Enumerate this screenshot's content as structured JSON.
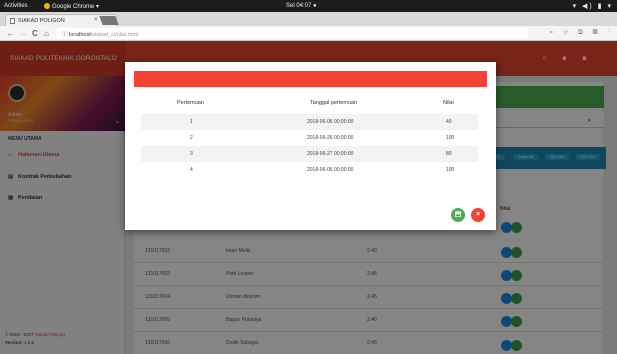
{
  "os": {
    "activities": "Activities",
    "app": "Google Chrome ▾",
    "clock": "Sel 04:07 ●",
    "sys_icons": "▾ ◀) ▮ ▾"
  },
  "browser": {
    "tab_title": "SIAKAD POLIGON",
    "tab_close": "×",
    "url_host": "localhost",
    "url_path": "/siakad_ci/nilai.html",
    "back": "←",
    "forward": "→",
    "reload": "C",
    "home": "⌂",
    "info": "ⓘ",
    "toolbar_icons": "⌕ ☆ ⧉ ▦ ⋮"
  },
  "app": {
    "brand": "SIAKAD POLITEKNIK GORONTALO",
    "header_icons": "⌕ ◼ ◼ ⋮",
    "profile": {
      "name": "Admin",
      "email": "Polgon.ac.id",
      "chevron": "⌄"
    },
    "menu_heading": "MENU UTAMA",
    "menu": [
      {
        "label": "Halaman Utama",
        "icon": "home-icon",
        "glyph": "⌂"
      },
      {
        "label": "Kontrak Perkuliahan",
        "icon": "list-icon",
        "glyph": "▤"
      },
      {
        "label": "Penilaian",
        "icon": "grid-icon",
        "glyph": "▦"
      }
    ],
    "footer": {
      "copyright_prefix": "© 2016 - 2017",
      "copyright_name": "Siakad Poligon",
      "version_label": "Version:",
      "version": "1.0.5"
    }
  },
  "background_table": {
    "pills": [
      "Tu",
      "Tugas UK",
      "UAS UKK",
      "UTS UKK"
    ],
    "nilai_header": "Nilai",
    "rows": [
      {
        "nim": "131017002",
        "nama": "Intan Meiki",
        "nilai": "2.40"
      },
      {
        "nim": "131017003",
        "nama": "Putri Lestari",
        "nilai": "2.45"
      },
      {
        "nim": "131017004",
        "nama": "Usman Ibrahim",
        "nilai": "2.45"
      },
      {
        "nim": "131017005",
        "nama": "Bagus Prasetya",
        "nilai": "2.40"
      },
      {
        "nim": "131017006",
        "nama": "Dodik Subagio",
        "nilai": "2.45"
      }
    ]
  },
  "modal": {
    "headers": {
      "pertemuan": "Pertemuan",
      "tanggal": "Tanggal pertemuan",
      "nilai": "Nilai"
    },
    "rows": [
      {
        "pertemuan": "1",
        "tanggal": "2018-06-06 00:00:00",
        "nilai": "40"
      },
      {
        "pertemuan": "2",
        "tanggal": "2018-06-26 00:00:00",
        "nilai": "100"
      },
      {
        "pertemuan": "3",
        "tanggal": "2018-06-27 00:00:00",
        "nilai": "80"
      },
      {
        "pertemuan": "4",
        "tanggal": "2018-06-06 00:00:00",
        "nilai": "100"
      }
    ],
    "save_glyph": "⬒",
    "close_glyph": "×"
  },
  "colors": {
    "header_red": "#e3472f",
    "modal_red": "#f44336",
    "green": "#4caf50",
    "blue": "#1e88b5"
  }
}
